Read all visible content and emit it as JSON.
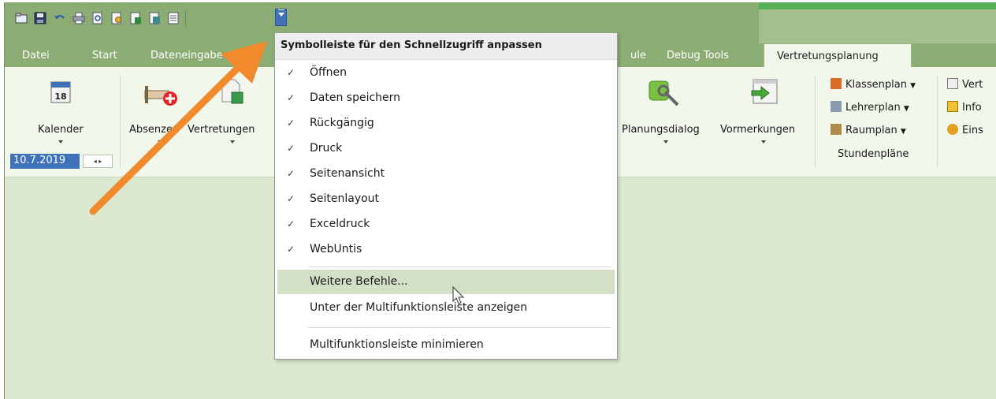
{
  "tabs": [
    "Datei",
    "Start",
    "Dateneingabe",
    "ule",
    "Debug Tools"
  ],
  "active_tab": "Vertretungsplanung",
  "ribbon": {
    "kalender": "Kalender",
    "absenzen": "Absenzen",
    "vertretungen": "Vertretungen",
    "planungsdialog": "Planungsdialog",
    "vormerkungen": "Vormerkungen",
    "calendar_day": "18",
    "date_value": "10.7.2019",
    "spin_arrows": "◂ ▸",
    "stundenplaene": {
      "items": [
        "Klassenplan",
        "Lehrerplan",
        "Raumplan"
      ],
      "group_label": "Stundenpläne"
    },
    "right_items": [
      "Vert",
      "Info",
      "Eins"
    ]
  },
  "menu": {
    "title": "Symbolleiste für den Schnellzugriff anpassen",
    "check_glyph": "✓",
    "checked_items": [
      "Öffnen",
      "Daten speichern",
      "Rückgängig",
      "Druck",
      "Seitenansicht",
      "Seitenlayout",
      "Exceldruck",
      "WebUntis"
    ],
    "more_commands": "Weitere Befehle...",
    "show_below": "Unter der Multifunktionsleiste anzeigen",
    "minimize": "Multifunktionsleiste minimieren"
  },
  "colors": {
    "ribbon_green": "#8bad73",
    "workspace": "#dce9d0",
    "accent_blue": "#3f72b9",
    "arrow_orange": "#f08a2c",
    "hover_green": "#d3e0c7"
  }
}
